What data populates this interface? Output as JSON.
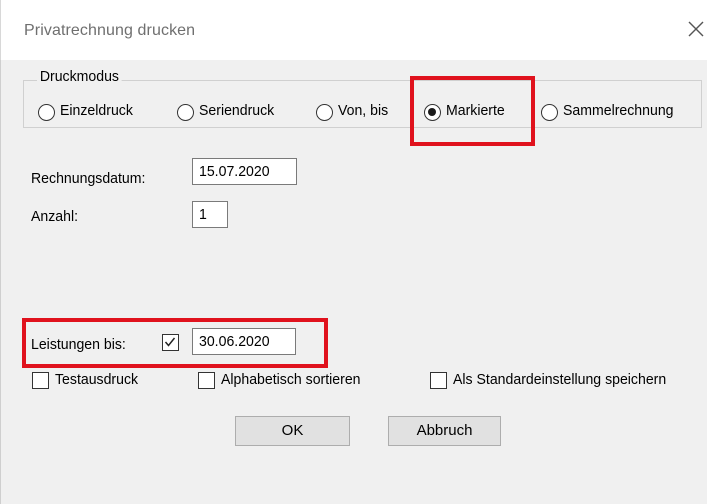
{
  "dialog": {
    "title": "Privatrechnung drucken",
    "close_icon": "close-icon"
  },
  "druckmodus": {
    "legend": "Druckmodus",
    "options": [
      {
        "label": "Einzeldruck",
        "selected": false
      },
      {
        "label": "Seriendruck",
        "selected": false
      },
      {
        "label": "Von, bis",
        "selected": false
      },
      {
        "label": "Markierte",
        "selected": true
      },
      {
        "label": "Sammelrechnung",
        "selected": false
      }
    ]
  },
  "rechnungsdatum": {
    "label": "Rechnungsdatum:",
    "value": "15.07.2020"
  },
  "anzahl": {
    "label": "Anzahl:",
    "value": "1"
  },
  "leistungen": {
    "label": "Leistungen bis:",
    "checked": true,
    "value": "30.06.2020"
  },
  "options": {
    "testausdruck": {
      "label": "Testausdruck",
      "checked": false
    },
    "alphabetisch": {
      "label": "Alphabetisch sortieren",
      "checked": false
    },
    "standard": {
      "label": "Als Standardeinstellung speichern",
      "checked": false
    }
  },
  "buttons": {
    "ok": "OK",
    "cancel": "Abbruch"
  },
  "colors": {
    "highlight": "#e0121d",
    "client_bg": "#f0f0f0"
  }
}
